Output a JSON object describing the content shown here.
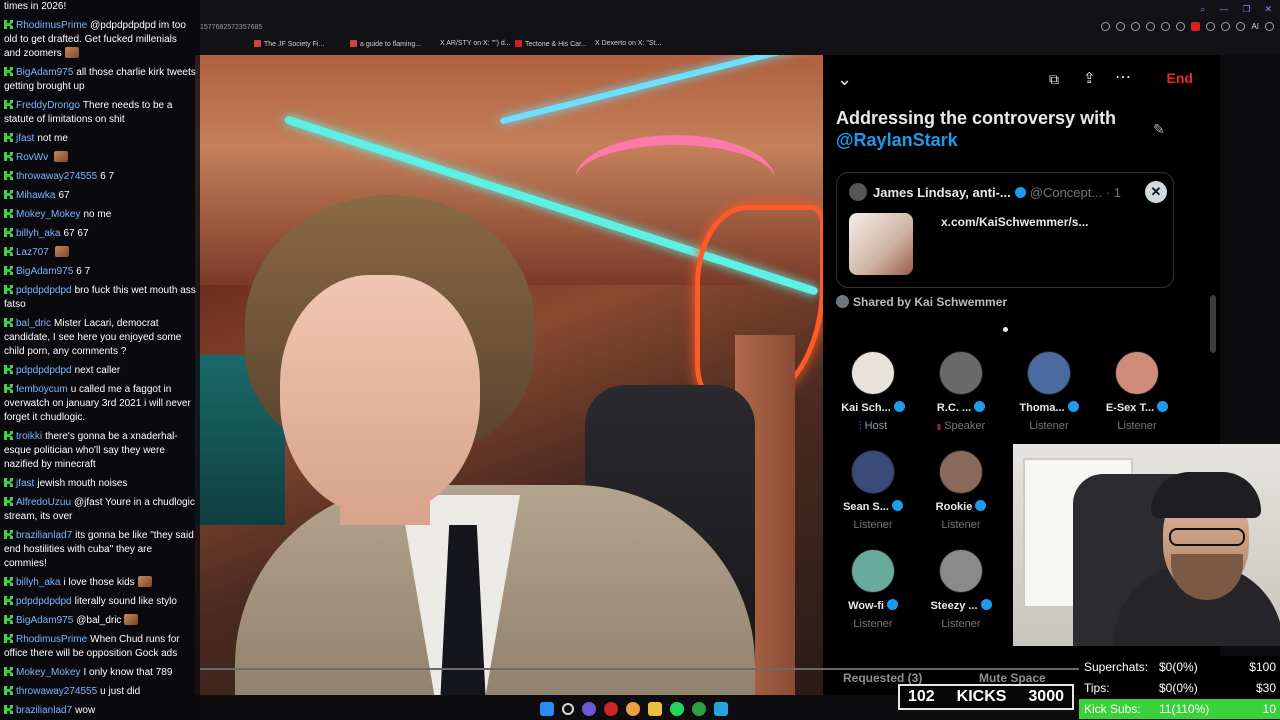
{
  "chat": [
    {
      "user": "",
      "text": "times in 2026!",
      "emote": false
    },
    {
      "user": "RhodimusPrime",
      "text": "@pdpdpdpdpd im too old to get drafted. Get fucked millenials and zoomers",
      "emote": true
    },
    {
      "user": "BigAdam975",
      "text": "all those charlie kirk tweets getting brought up",
      "emote": false
    },
    {
      "user": "FreddyDrongo",
      "text": "There needs to be a statute of limitations on shit",
      "emote": false
    },
    {
      "user": "jfast",
      "text": "not me",
      "emote": false
    },
    {
      "user": "RovWv",
      "text": "",
      "emote": true
    },
    {
      "user": "throwaway274555",
      "text": "6 7",
      "emote": false
    },
    {
      "user": "Mihawka",
      "text": "67",
      "emote": false
    },
    {
      "user": "Mokey_Mokey",
      "text": "no me",
      "emote": false
    },
    {
      "user": "billyh_aka",
      "text": "67 67",
      "emote": false
    },
    {
      "user": "Laz707",
      "text": "",
      "emote": true
    },
    {
      "user": "BigAdam975",
      "text": "6 7",
      "emote": false
    },
    {
      "user": "pdpdpdpdpd",
      "text": "bro fuck this wet mouth ass fatso",
      "emote": false
    },
    {
      "user": "bal_dric",
      "text": "Mister Lacari, democrat candidate, I see here you enjoyed some child porn, any comments ?",
      "emote": false
    },
    {
      "user": "pdpdpdpdpd",
      "text": "next caller",
      "emote": false
    },
    {
      "user": "femboycum",
      "text": "u called me a faggot in overwatch on january 3rd 2021 i will never forget it chudlogic.",
      "emote": false
    },
    {
      "user": "troikki",
      "text": "there's gonna be a xnaderhal-esque politician who'll say they were nazified by minecraft",
      "emote": false
    },
    {
      "user": "jfast",
      "text": "jewish mouth noises",
      "emote": false
    },
    {
      "user": "AlfredoUzuu",
      "text": "@jfast Youre in a chudlogic stream, its over",
      "emote": false
    },
    {
      "user": "brazilianlad7",
      "text": "its gonna be like \"they said end hostilities with cuba\" they are commies!",
      "emote": false
    },
    {
      "user": "billyh_aka",
      "text": "i love those kids",
      "emote": true
    },
    {
      "user": "pdpdpdpdpd",
      "text": "literally sound like stylo",
      "emote": false
    },
    {
      "user": "BigAdam975",
      "text": "@bal_dric",
      "emote": true
    },
    {
      "user": "RhodimusPrime",
      "text": "When Chud runs for office there will be opposition Gock ads",
      "emote": false
    },
    {
      "user": "Mokey_Mokey",
      "text": "I only know that 789",
      "emote": false
    },
    {
      "user": "throwaway274555",
      "text": "u just did",
      "emote": false
    },
    {
      "user": "brazilianlad7",
      "text": "wow",
      "emote": false
    }
  ],
  "browser": {
    "address": "1577682572357685",
    "bookmarks": [
      {
        "label": "The JF Society Fi...",
        "color": "#d64040"
      },
      {
        "label": "a guide to flaming...",
        "color": "#d64040"
      },
      {
        "label": "X  AR/STY on X: \"\") d...",
        "color": "#e0e0e0"
      },
      {
        "label": "Tectone & His Car...",
        "color": "#d62020"
      },
      {
        "label": "X  Dexerto on X: \"St...",
        "color": "#e0e0e0"
      }
    ],
    "ai_label": "AI"
  },
  "space": {
    "end_label": "End",
    "title": "Addressing the controversy with",
    "mention": "@RaylanStark",
    "pinned": {
      "author": "James Lindsay, anti-...",
      "handle": "@Concept... · 1",
      "link": "x.com/KaiSchwemmer/s...",
      "close_icon": "✕"
    },
    "shared_by": "Shared by Kai Schwemmer",
    "participants": [
      {
        "name": "Kai Sch...",
        "role": "Host",
        "role_type": "host",
        "verified": true,
        "color": "#e8e2dc"
      },
      {
        "name": "R.C. ...",
        "role": "Speaker",
        "role_type": "speaker",
        "verified": true,
        "color": "#6a6a6a"
      },
      {
        "name": "Thoma...",
        "role": "Listener",
        "role_type": "listener",
        "verified": true,
        "color": "#4a6aa0"
      },
      {
        "name": "E-Sex T...",
        "role": "Listener",
        "role_type": "listener",
        "verified": true,
        "color": "#d08a7a"
      },
      {
        "name": "Sean S...",
        "role": "Listener",
        "role_type": "listener",
        "verified": true,
        "color": "#3a4a7a"
      },
      {
        "name": "Rookie",
        "role": "Listener",
        "role_type": "listener",
        "verified": true,
        "color": "#8a6a5a"
      },
      {
        "name": "Wow-fi",
        "role": "Listener",
        "role_type": "listener",
        "verified": true,
        "color": "#6aaa9a"
      },
      {
        "name": "Steezy ...",
        "role": "Listener",
        "role_type": "listener",
        "verified": true,
        "color": "#8a8a8a"
      }
    ],
    "requested": "Requested (3)",
    "mute_space": "Mute Space"
  },
  "kicks": {
    "count": "102",
    "label": "KICKS",
    "goal": "3000"
  },
  "goals": [
    {
      "label": "Superchats:",
      "value": "$0(0%)",
      "target": "$100",
      "style": "normal"
    },
    {
      "label": "Tips:",
      "value": "$0(0%)",
      "target": "$30",
      "style": "normal"
    },
    {
      "label": "Kick Subs:",
      "value": "11(110%)",
      "target": "10",
      "style": "kick"
    }
  ],
  "colors": {
    "accent_blue": "#1d9bf0",
    "end_red": "#f4212e",
    "kick_green": "#3ad23a"
  }
}
